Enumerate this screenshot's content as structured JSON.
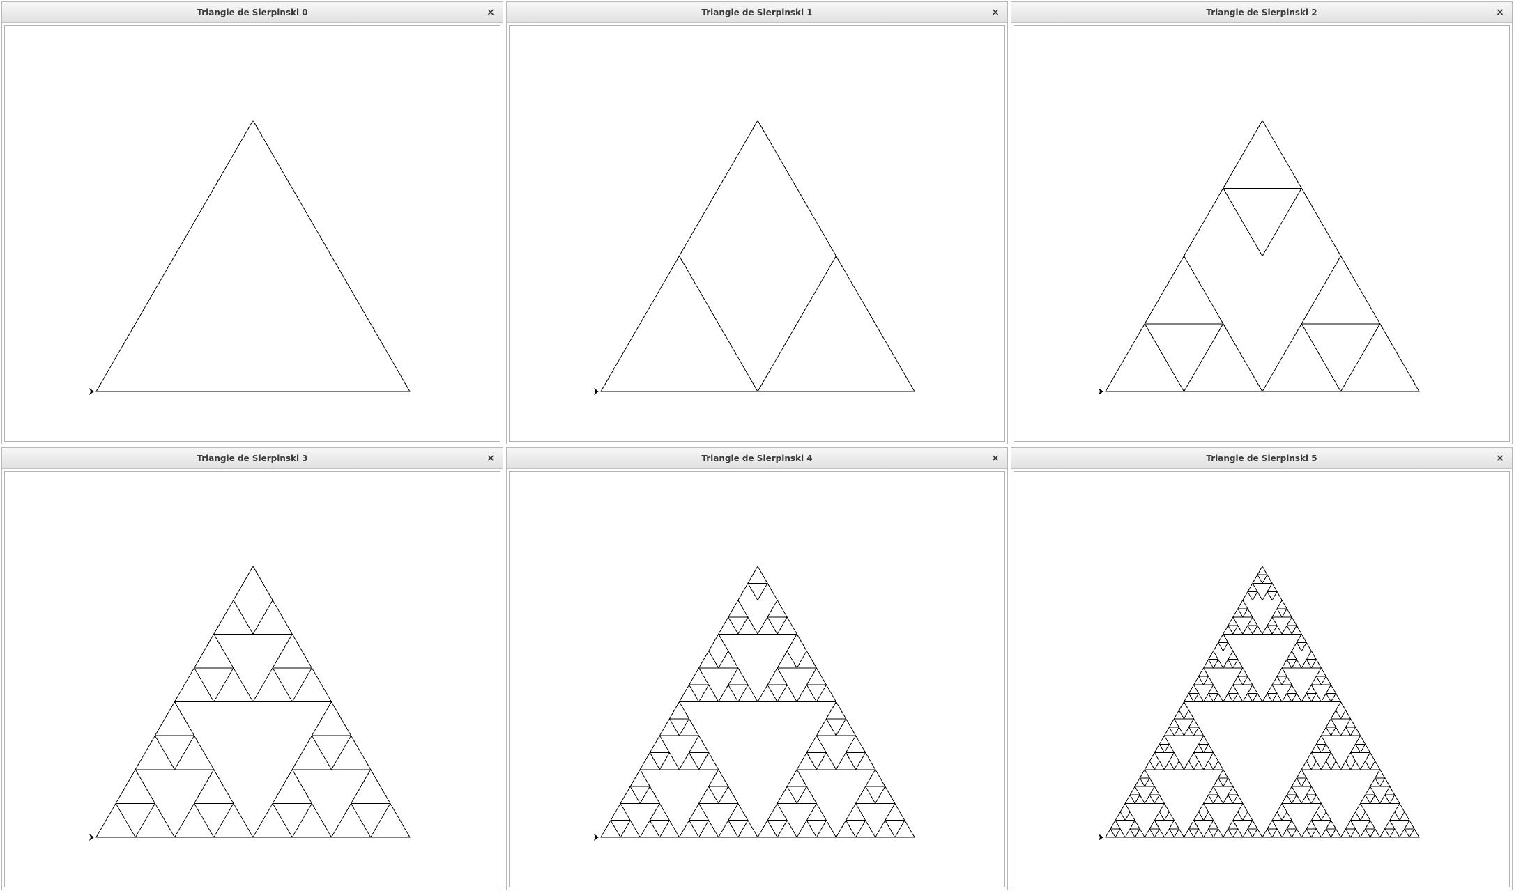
{
  "windows": [
    {
      "title": "Triangle de Sierpinski 0",
      "close_label": "×",
      "depth": 0
    },
    {
      "title": "Triangle de Sierpinski 1",
      "close_label": "×",
      "depth": 1
    },
    {
      "title": "Triangle de Sierpinski 2",
      "close_label": "×",
      "depth": 2
    },
    {
      "title": "Triangle de Sierpinski 3",
      "close_label": "×",
      "depth": 3
    },
    {
      "title": "Triangle de Sierpinski 4",
      "close_label": "×",
      "depth": 4
    },
    {
      "title": "Triangle de Sierpinski 5",
      "close_label": "×",
      "depth": 5
    }
  ],
  "colors": {
    "stroke": "#000000",
    "turtle": "#000000"
  },
  "icons": {
    "close": "close-icon",
    "turtle": "turtle-arrow-icon"
  }
}
